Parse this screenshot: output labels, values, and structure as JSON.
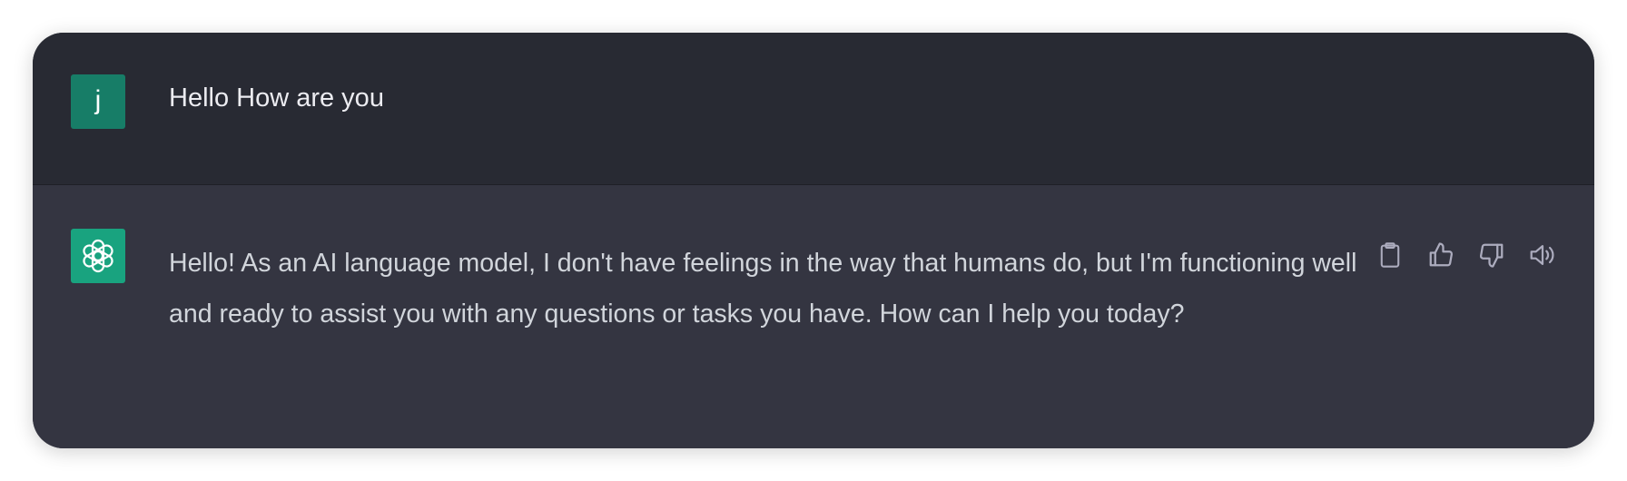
{
  "conversation": {
    "user_message": {
      "avatar_initial": "j",
      "text": "Hello How are you"
    },
    "assistant_message": {
      "text": "Hello! As an AI language model, I don't have feelings in the way that humans do, but I'm functioning well and ready to assist you with any questions or tasks you have. How can I help you today?"
    },
    "actions": [
      {
        "icon": "clipboard-icon"
      },
      {
        "icon": "thumbs-up-icon"
      },
      {
        "icon": "thumbs-down-icon"
      },
      {
        "icon": "speaker-icon"
      }
    ]
  },
  "colors": {
    "user_row_bg": "#282a33",
    "assistant_row_bg": "#343541",
    "user_avatar": "#177d67",
    "assistant_avatar": "#19a37f",
    "text_primary": "#ececf1",
    "text_secondary": "#d1d5db",
    "icon": "#acacbe"
  }
}
